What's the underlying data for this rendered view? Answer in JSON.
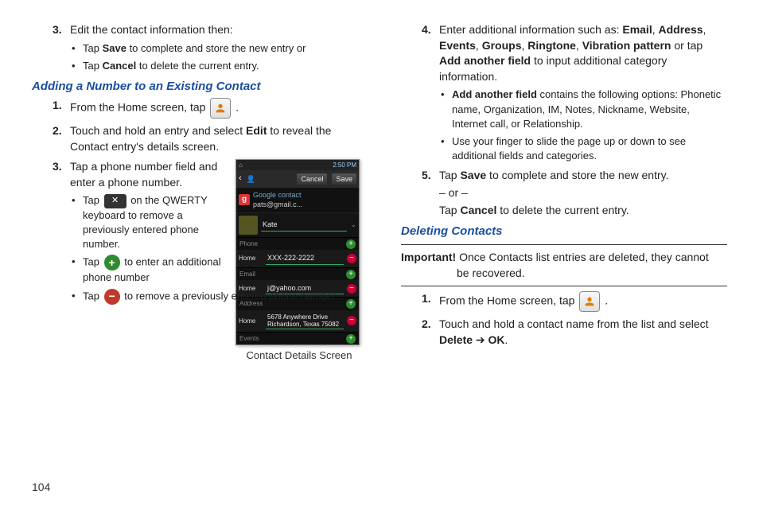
{
  "page_number": "104",
  "left": {
    "step3_a": {
      "num": "3.",
      "text": "Edit the contact information then:",
      "b1_pre": "Tap ",
      "b1_bold": "Save",
      "b1_post": " to complete and store the new entry or",
      "b2_pre": "Tap ",
      "b2_bold": "Cancel",
      "b2_post": " to delete the current entry."
    },
    "heading_adding": "Adding a Number to an Existing Contact",
    "s1": {
      "num": "1.",
      "pre": "From the Home screen, tap ",
      "post": " ."
    },
    "s2": {
      "num": "2.",
      "t1": "Touch and hold an entry and select ",
      "bold": "Edit",
      "t2": " to reveal the Contact entry's details screen."
    },
    "s3": {
      "num": "3.",
      "text": "Tap a phone number field and enter a phone number.",
      "b1_pre": "Tap ",
      "b1_post": " on the QWERTY keyboard to remove a previously entered phone number.",
      "b2_pre": "Tap ",
      "b2_post": " to enter an additional phone number",
      "b3_pre": "Tap ",
      "b3_post": " to remove a previously entered phone number."
    },
    "phone_caption": "Contact Details Screen",
    "phone": {
      "status_left": "⌂",
      "status_right": "2:50 PM",
      "cancel": "Cancel",
      "save": "Save",
      "g": "g",
      "google_contact": "Google contact",
      "email_top": "pats@gmail.c...",
      "name": "Kate",
      "lbl_phone": "Phone",
      "type_home": "Home",
      "phone_val": "XXX-222-2222",
      "lbl_email": "Email",
      "email_val": "j@yahoo.com",
      "lbl_address": "Address",
      "addr_l1": "5678 Anywhere Drive",
      "addr_l2": "Richardson, Texas 75082",
      "lbl_events": "Events"
    }
  },
  "right": {
    "s4": {
      "num": "4.",
      "t1": "Enter additional information such as: ",
      "b_email": "Email",
      "c1": ", ",
      "b_address": "Address",
      "c2": ", ",
      "b_events": "Events",
      "c3": ", ",
      "b_groups": "Groups",
      "c4": ", ",
      "b_ringtone": "Ringtone",
      "c5": ", ",
      "b_vib": "Vibration pattern",
      "t2": " or tap ",
      "b_add": "Add another field",
      "t3": " to input additional category information.",
      "bul1_bold": "Add another field",
      "bul1_rest": " contains the following options: Phonetic name, Organization, IM, Notes, Nickname, Website, Internet call, or Relationship.",
      "bul2": "Use your finger to slide the page up or down to see additional fields and categories."
    },
    "s5": {
      "num": "5.",
      "t1": "Tap ",
      "b_save": "Save",
      "t2": " to complete and store the new entry.",
      "or": "– or –",
      "t3": "Tap ",
      "b_cancel": "Cancel",
      "t4": " to delete the current entry."
    },
    "heading_deleting": "Deleting Contacts",
    "important_label": "Important!",
    "important_text_1": " Once Contacts list entries are deleted, they cannot",
    "important_text_2": "be recovered.",
    "d1": {
      "num": "1.",
      "pre": "From the Home screen, tap ",
      "post": " ."
    },
    "d2": {
      "num": "2.",
      "t1": "Touch and hold a contact name from the list and select ",
      "b_delete": "Delete",
      "arrow": " ➔ ",
      "b_ok": "OK",
      "t2": "."
    }
  }
}
